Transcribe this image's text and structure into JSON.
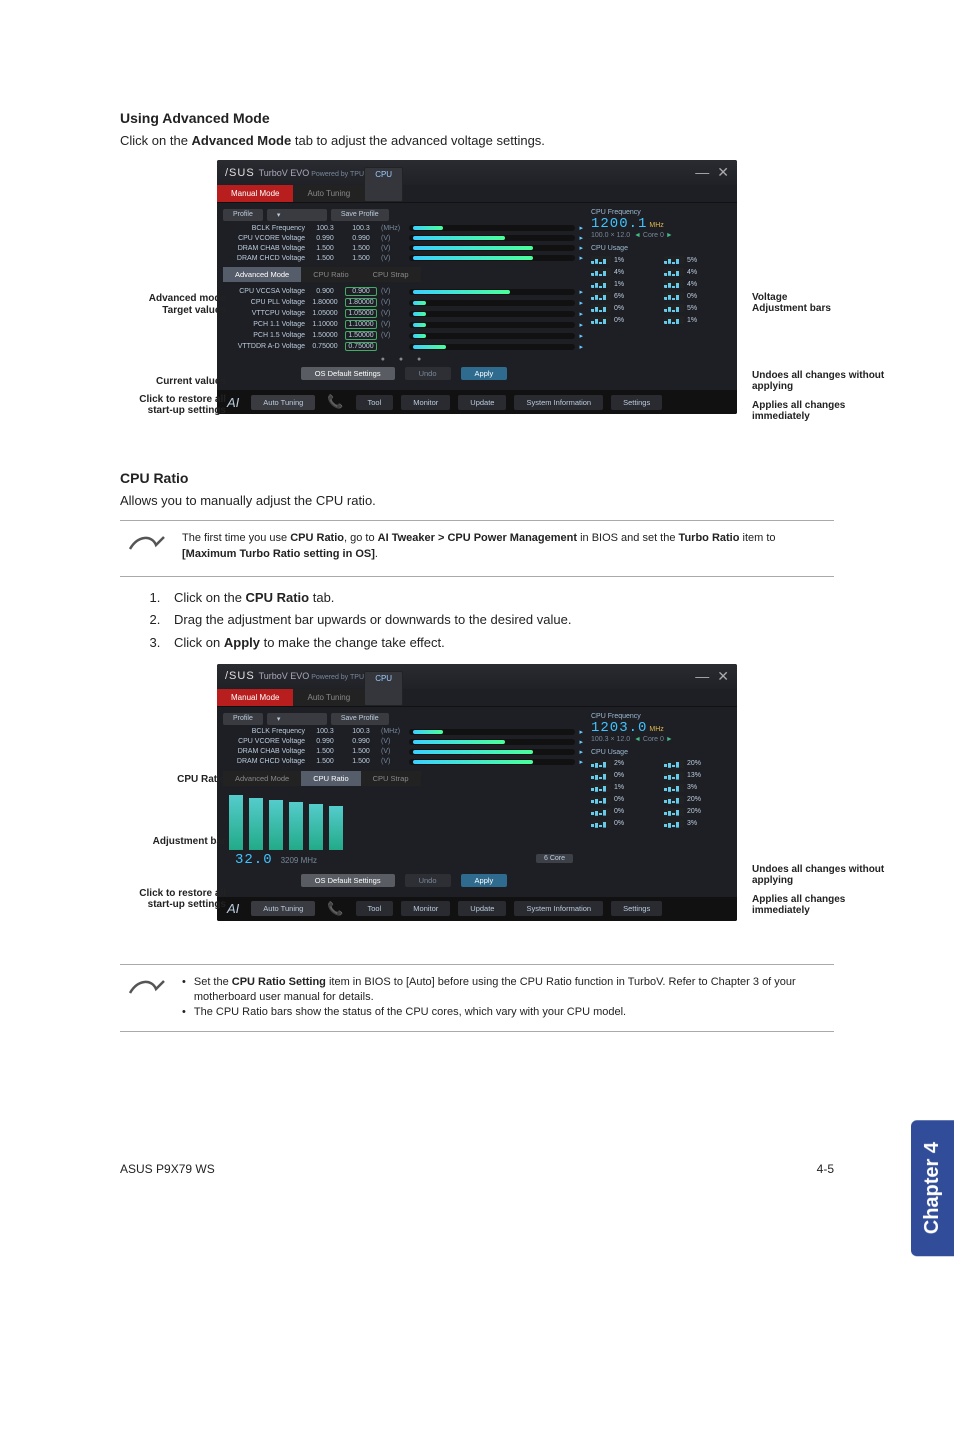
{
  "page": {
    "section1_heading": "Using Advanced Mode",
    "section1_body_pre": "Click on the ",
    "section1_body_bold": "Advanced Mode",
    "section1_body_post": " tab to adjust the advanced voltage settings.",
    "section2_heading": "CPU Ratio",
    "section2_body": "Allows you to manually adjust the CPU ratio.",
    "note1_pre": "The first time you use ",
    "note1_b1": "CPU Ratio",
    "note1_mid1": ", go to ",
    "note1_b2": "AI Tweaker > CPU Power Management",
    "note1_mid2": " in BIOS and set the ",
    "note1_b3": "Turbo Ratio",
    "note1_mid3": " item to ",
    "note1_b4": "[Maximum Turbo Ratio setting in OS]",
    "note1_post": ".",
    "step1_pre": "Click on the ",
    "step1_b": "CPU Ratio",
    "step1_post": " tab.",
    "step2": "Drag the adjustment bar upwards or downwards to the desired value.",
    "step3_pre": "Click on ",
    "step3_b": "Apply",
    "step3_post": " to make the change take effect.",
    "note2_line1_pre": "Set the ",
    "note2_line1_b": "CPU Ratio Setting",
    "note2_line1_post": " item in BIOS to [Auto] before using the CPU Ratio function in TurboV. Refer to Chapter 3 of your motherboard user manual for details.",
    "note2_line2": "The CPU Ratio bars show the status of the CPU cores, which vary with your CPU model.",
    "chapter_tab": "Chapter 4",
    "footer_left": "ASUS P9X79 WS",
    "footer_right": "4-5"
  },
  "callouts": {
    "advanced_mode": "Advanced mode",
    "target_values": "Target values",
    "current_values": "Current values",
    "click_restore": "Click to restore all start-up settings",
    "voltage_bars": "Voltage Adjustment bars",
    "undoes": "Undoes all changes without applying",
    "applies": "Applies all changes immediately",
    "cpu_ratio": "CPU Ratio",
    "adjustment_bar": "Adjustment bar"
  },
  "app": {
    "brand": "/SUS",
    "product": "TurboV EVO",
    "powered": "Powered by TPU",
    "tab_manual": "Manual Mode",
    "tab_auto": "Auto Tuning",
    "cpu_label": "CPU",
    "profile_label": "Profile",
    "save_profile": "Save Profile",
    "subtab_advanced": "Advanced Mode",
    "subtab_cpuratio": "CPU Ratio",
    "subtab_cpustrap": "CPU Strap",
    "os_default": "OS Default Settings",
    "undo": "Undo",
    "apply": "Apply",
    "bb_auto": "Auto Tuning",
    "bb_tool": "Tool",
    "bb_monitor": "Monitor",
    "bb_update": "Update",
    "bb_sysinfo": "System Information",
    "bb_settings": "Settings",
    "cpu_freq_label": "CPU Frequency",
    "cpu_usage_label": "CPU Usage",
    "profile_rows": [
      {
        "name": "BCLK Frequency",
        "v1": "100.3",
        "v2": "100.3",
        "unit": "(MHz)",
        "fill": 18
      },
      {
        "name": "CPU VCORE Voltage",
        "v1": "0.990",
        "v2": "0.990",
        "unit": "(V)",
        "fill": 55
      },
      {
        "name": "DRAM CHAB Voltage",
        "v1": "1.500",
        "v2": "1.500",
        "unit": "(V)",
        "fill": 72
      },
      {
        "name": "DRAM CHCD Voltage",
        "v1": "1.500",
        "v2": "1.500",
        "unit": "(V)",
        "fill": 72
      }
    ],
    "adv_rows": [
      {
        "name": "CPU VCCSA Voltage",
        "v1": "0.900",
        "v2": "0.900",
        "unit": "(V)",
        "fill": 58
      },
      {
        "name": "CPU PLL Voltage",
        "v1": "1.80000",
        "v2": "1.80000",
        "unit": "(V)",
        "fill": 8
      },
      {
        "name": "VTTCPU Voltage",
        "v1": "1.05000",
        "v2": "1.05000",
        "unit": "(V)",
        "fill": 8
      },
      {
        "name": "PCH 1.1 Voltage",
        "v1": "1.10000",
        "v2": "1.10000",
        "unit": "(V)",
        "fill": 8
      },
      {
        "name": "PCH 1.5 Voltage",
        "v1": "1.50000",
        "v2": "1.50000",
        "unit": "(V)",
        "fill": 8
      },
      {
        "name": "VTTDDR A-D Voltage",
        "v1": "0.75000",
        "v2": "0.75000",
        "unit": "",
        "fill": 20
      }
    ],
    "freq1": "1200.1",
    "freq1_sub": "100.0 × 12.0",
    "freq1_core": "Core 0",
    "usage1": [
      "1%",
      "5%",
      "4%",
      "4%",
      "1%",
      "4%",
      "6%",
      "0%",
      "0%",
      "5%",
      "0%",
      "1%"
    ],
    "freq2": "1203.0",
    "freq2_sub": "100.3 × 12.0",
    "freq2_core": "Core 0",
    "usage2": [
      "2%",
      "20%",
      "0%",
      "13%",
      "1%",
      "3%",
      "0%",
      "20%",
      "0%",
      "20%",
      "0%",
      "3%"
    ],
    "ratio_value": "32.0",
    "ratio_freq": "3209 MHz",
    "core_badge": "6 Core",
    "mhz_label": "MHz",
    "arrow_left": "◄",
    "arrow_right": "►"
  }
}
